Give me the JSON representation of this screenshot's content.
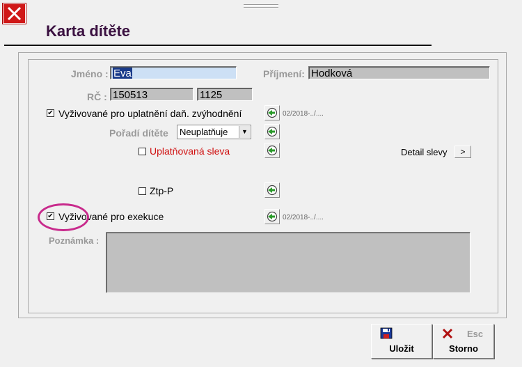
{
  "window": {
    "title": "Karta dítěte"
  },
  "form": {
    "jmeno_label": "Jméno :",
    "jmeno_value": "Eva",
    "prijmeni_label": "Příjmení:",
    "prijmeni_value": "Hodková",
    "rc_label": "RČ :",
    "rc_value1": "150513",
    "rc_value2": "1125",
    "vyzivovane_dan_label": "Vyživované pro uplatnění daň. zvýhodnění",
    "vyzivovane_dan_checked": true,
    "vyzivovane_dan_date": "02/2018-../....",
    "poradi_label": "Pořadí dítěte",
    "poradi_value": "Neuplatňuje",
    "uplatnovana_label": "Uplatňovaná sleva",
    "uplatnovana_checked": false,
    "detail_slevy_label": "Detail slevy",
    "detail_slevy_arrow": ">",
    "ztp_label": "Ztp-P",
    "ztp_checked": false,
    "exekuce_label": "Vyživované pro exekuce",
    "exekuce_checked": true,
    "exekuce_date": "02/2018-../....",
    "poznamka_label": "Poznámka :"
  },
  "buttons": {
    "ulozit_label": "Uložit",
    "storno_label": "Storno",
    "esc_label": "Esc"
  },
  "colors": {
    "title": "#3a1040",
    "close": "#d01818",
    "annotation": "#c82a8c",
    "red_label": "#d01010"
  },
  "icons": {
    "close": "close-icon",
    "history": "history-arrow-icon",
    "save": "save-icon",
    "cancel": "cancel-x-icon"
  }
}
